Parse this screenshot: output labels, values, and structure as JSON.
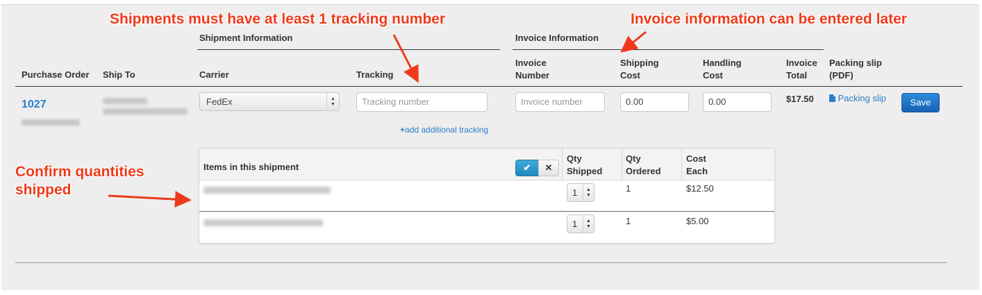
{
  "table": {
    "group_headers": {
      "shipment_information": "Shipment Information",
      "invoice_information": "Invoice Information"
    },
    "columns": {
      "purchase_order": "Purchase Order",
      "ship_to": "Ship To",
      "carrier": "Carrier",
      "tracking": "Tracking",
      "invoice_number_l1": "Invoice",
      "invoice_number_l2": "Number",
      "shipping_cost_l1": "Shipping",
      "shipping_cost_l2": "Cost",
      "handling_cost_l1": "Handling",
      "handling_cost_l2": "Cost",
      "invoice_total_l1": "Invoice",
      "invoice_total_l2": "Total",
      "packing_slip_l1": "Packing slip",
      "packing_slip_l2": "(PDF)"
    }
  },
  "order": {
    "po_number": "1027",
    "carrier": "FedEx",
    "tracking_placeholder": "Tracking number",
    "add_tracking_label": "add additional tracking",
    "invoice_placeholder": "Invoice number",
    "shipping_cost": "0.00",
    "handling_cost": "0.00",
    "invoice_total": "$17.50",
    "packing_slip_label": "Packing slip",
    "save_label": "Save"
  },
  "items": {
    "header": "Items in this shipment",
    "check_icon": "check-icon",
    "clear_icon": "close-icon",
    "qty_shipped_l1": "Qty",
    "qty_shipped_l2": "Shipped",
    "qty_ordered_l1": "Qty",
    "qty_ordered_l2": "Ordered",
    "cost_each_l1": "Cost",
    "cost_each_l2": "Each",
    "rows": [
      {
        "qty_shipped": "1",
        "qty_ordered": "1",
        "cost_each": "$12.50"
      },
      {
        "qty_shipped": "1",
        "qty_ordered": "1",
        "cost_each": "$5.00"
      }
    ]
  },
  "annotations": {
    "tracking_note": "Shipments must have at least 1 tracking number",
    "invoice_note": "Invoice information can be entered later",
    "confirm_l1": "Confirm quantities",
    "confirm_l2": "shipped"
  },
  "colors": {
    "annotation": "#ee3a1a",
    "link": "#2a7ec8",
    "primary_button": "#1f74c6"
  }
}
